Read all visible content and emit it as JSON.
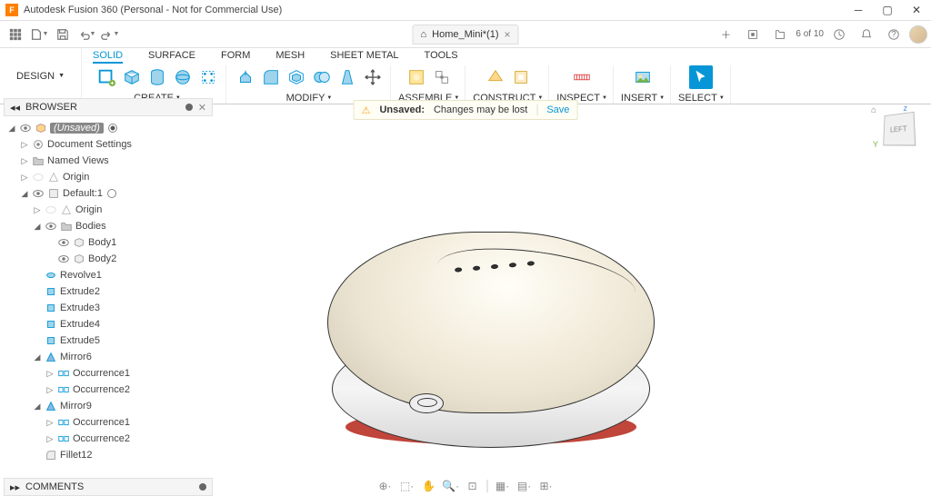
{
  "window": {
    "title": "Autodesk Fusion 360 (Personal - Not for Commercial Use)"
  },
  "tab": {
    "name": "Home_Mini*(1)"
  },
  "jobs": {
    "count": "6 of 10"
  },
  "ribbon": {
    "workspace": "DESIGN",
    "tabs": [
      "SOLID",
      "SURFACE",
      "FORM",
      "MESH",
      "SHEET METAL",
      "TOOLS"
    ],
    "groups": {
      "create": "CREATE",
      "modify": "MODIFY",
      "assemble": "ASSEMBLE",
      "construct": "CONSTRUCT",
      "inspect": "INSPECT",
      "insert": "INSERT",
      "select": "SELECT"
    }
  },
  "alert": {
    "title": "Unsaved:",
    "msg": "Changes may be lost",
    "action": "Save"
  },
  "browser": {
    "title": "BROWSER",
    "root": "(Unsaved)",
    "docset": "Document Settings",
    "views": "Named Views",
    "origin": "Origin",
    "default": "Default:1",
    "origin2": "Origin",
    "bodies": "Bodies",
    "body1": "Body1",
    "body2": "Body2",
    "rev": "Revolve1",
    "ex2": "Extrude2",
    "ex3": "Extrude3",
    "ex4": "Extrude4",
    "ex5": "Extrude5",
    "mir6": "Mirror6",
    "occ1": "Occurrence1",
    "occ2": "Occurrence2",
    "mir9": "Mirror9",
    "occ1b": "Occurrence1",
    "occ2b": "Occurrence2",
    "fil": "Fillet12"
  },
  "viewcube": {
    "face": "LEFT"
  },
  "comments": {
    "title": "COMMENTS"
  }
}
